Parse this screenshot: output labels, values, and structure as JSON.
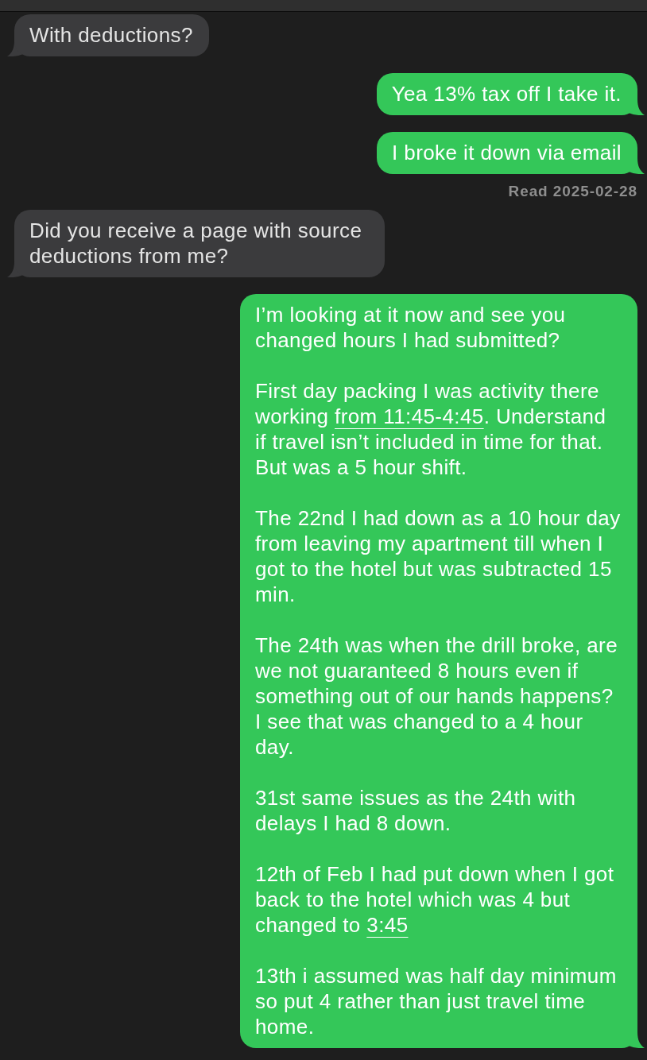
{
  "messages": [
    {
      "kind": "received",
      "paragraphs": [
        [
          {
            "kind": "text",
            "text": "With deductions?"
          }
        ]
      ]
    },
    {
      "kind": "sent",
      "paragraphs": [
        [
          {
            "kind": "text",
            "text": "Yea 13% tax off I take it."
          }
        ]
      ]
    },
    {
      "kind": "sent",
      "paragraphs": [
        [
          {
            "kind": "text",
            "text": "I broke it down via email"
          }
        ]
      ]
    },
    {
      "kind": "receipt",
      "text": "Read 2025-02-28"
    },
    {
      "kind": "received",
      "paragraphs": [
        [
          {
            "kind": "text",
            "text": "Did you receive a page with source deductions from me?"
          }
        ]
      ]
    },
    {
      "kind": "sent",
      "paragraphs": [
        [
          {
            "kind": "text",
            "text": "I’m looking at it now and see you changed hours I had submitted?"
          }
        ],
        [
          {
            "kind": "text",
            "text": "First day packing I was activity there working "
          },
          {
            "kind": "link",
            "text": "from 11:45-4:45"
          },
          {
            "kind": "text",
            "text": ". Understand if travel isn’t included in time for that. But was a 5 hour shift."
          }
        ],
        [
          {
            "kind": "text",
            "text": "The 22nd I had down as a 10 hour day from leaving my apartment till when I got to the hotel but was subtracted 15 min."
          }
        ],
        [
          {
            "kind": "text",
            "text": "The 24th was when the drill broke, are we not guaranteed 8 hours even if something out of our hands happens? I see that was changed to a 4 hour day."
          }
        ],
        [
          {
            "kind": "text",
            "text": "31st same issues as the 24th with delays I had 8 down."
          }
        ],
        [
          {
            "kind": "text",
            "text": "12th of Feb I had put down when I got back to the hotel which was 4 but changed to "
          },
          {
            "kind": "link",
            "text": "3:45"
          }
        ],
        [
          {
            "kind": "text",
            "text": "13th i assumed was half day minimum so put 4 rather than just travel time home."
          }
        ]
      ]
    }
  ]
}
